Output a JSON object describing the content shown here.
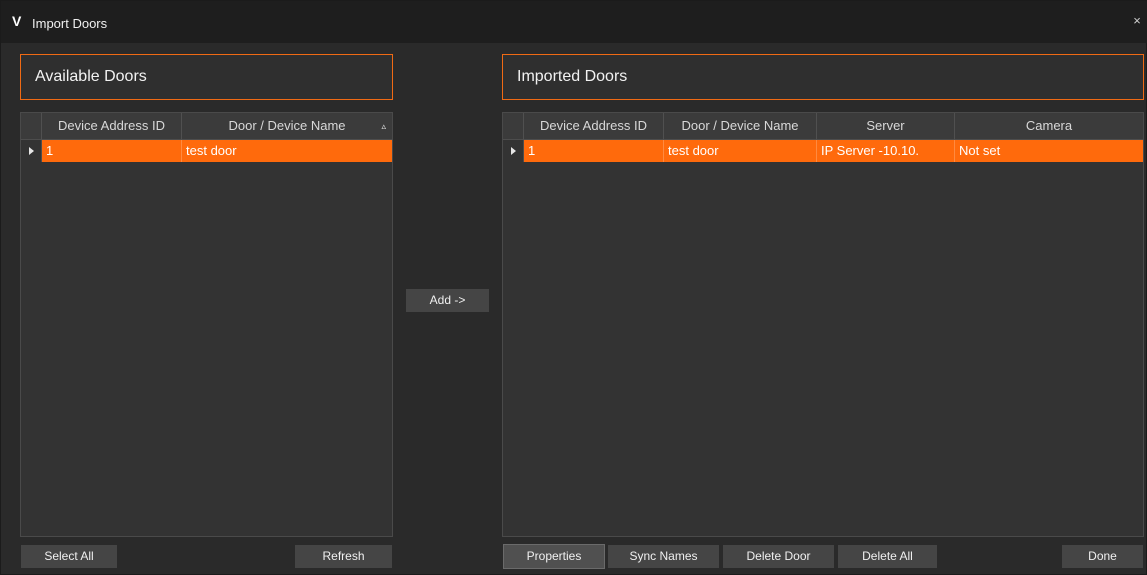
{
  "window": {
    "title": "Import Doors",
    "logo": "V",
    "close_glyph": "×"
  },
  "available": {
    "header": "Available Doors",
    "columns": [
      "Device Address ID",
      "Door / Device Name"
    ],
    "sort_glyph": "▵",
    "rows": [
      {
        "id": "1",
        "name": "test door"
      }
    ],
    "select_all_label": "Select All",
    "refresh_label": "Refresh"
  },
  "add_label": "Add ->",
  "imported": {
    "header": "Imported Doors",
    "columns": [
      "Device Address ID",
      "Door / Device Name",
      "Server",
      "Camera"
    ],
    "rows": [
      {
        "id": "1",
        "name": "test door",
        "server": "IP Server -10.10.",
        "camera": "Not set"
      }
    ],
    "properties_label": "Properties",
    "sync_names_label": "Sync Names",
    "delete_door_label": "Delete Door",
    "delete_all_label": "Delete All",
    "done_label": "Done"
  },
  "colors": {
    "accent": "#ff6a0c",
    "panel_border": "#f06a14",
    "background": "#2a2a2a"
  }
}
